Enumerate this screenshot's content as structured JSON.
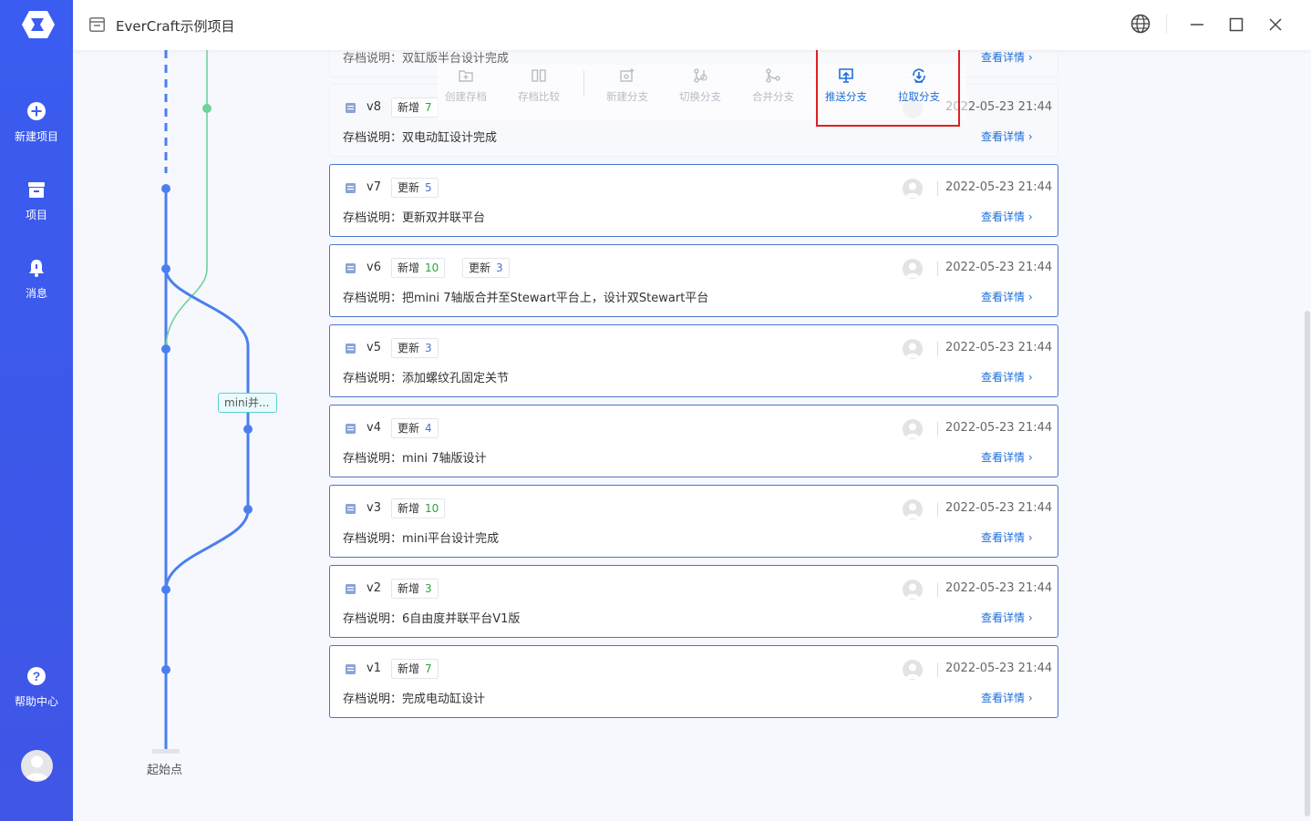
{
  "app": {
    "title": "EverCraft示例项目"
  },
  "sidebar": {
    "items": [
      {
        "label": "新建项目",
        "icon": "plus-circle-icon"
      },
      {
        "label": "项目",
        "icon": "archive-box-icon"
      },
      {
        "label": "消息",
        "icon": "bell-icon"
      },
      {
        "label": "帮助中心",
        "icon": "question-circle-icon"
      }
    ]
  },
  "toolbar": {
    "items": [
      {
        "label": "创建存档",
        "icon": "folder-plus-icon"
      },
      {
        "label": "存档比较",
        "icon": "compare-icon"
      },
      {
        "label": "新建分支",
        "icon": "new-branch-icon"
      },
      {
        "label": "切换分支",
        "icon": "switch-branch-icon"
      },
      {
        "label": "合并分支",
        "icon": "merge-branch-icon"
      },
      {
        "label": "推送分支",
        "icon": "push-branch-icon"
      },
      {
        "label": "拉取分支",
        "icon": "pull-branch-icon"
      }
    ]
  },
  "graph": {
    "start_label": "起始点",
    "branch_tag": "mini并..."
  },
  "top_partial": {
    "desc": "存档说明：双缸版半台设计完成",
    "detail": "查看详情"
  },
  "archives": [
    {
      "version": "v8",
      "tags": [
        {
          "label": "新增",
          "count": "7",
          "kind": "add"
        }
      ],
      "time": "2022-05-23 21:44",
      "desc": "存档说明：双电动缸设计完成",
      "detail": "查看详情"
    },
    {
      "version": "v7",
      "tags": [
        {
          "label": "更新",
          "count": "5",
          "kind": "update"
        }
      ],
      "time": "2022-05-23 21:44",
      "desc": "存档说明：更新双并联平台",
      "detail": "查看详情"
    },
    {
      "version": "v6",
      "tags": [
        {
          "label": "新增",
          "count": "10",
          "kind": "add"
        },
        {
          "label": "更新",
          "count": "3",
          "kind": "update"
        }
      ],
      "time": "2022-05-23 21:44",
      "desc": "存档说明：把mini 7轴版合并至Stewart平台上，设计双Stewart平台",
      "detail": "查看详情"
    },
    {
      "version": "v5",
      "tags": [
        {
          "label": "更新",
          "count": "3",
          "kind": "update"
        }
      ],
      "time": "2022-05-23 21:44",
      "desc": "存档说明：添加螺纹孔固定关节",
      "detail": "查看详情"
    },
    {
      "version": "v4",
      "tags": [
        {
          "label": "更新",
          "count": "4",
          "kind": "update"
        }
      ],
      "time": "2022-05-23 21:44",
      "desc": "存档说明：mini 7轴版设计",
      "detail": "查看详情"
    },
    {
      "version": "v3",
      "tags": [
        {
          "label": "新增",
          "count": "10",
          "kind": "add"
        }
      ],
      "time": "2022-05-23 21:44",
      "desc": "存档说明：mini平台设计完成",
      "detail": "查看详情"
    },
    {
      "version": "v2",
      "tags": [
        {
          "label": "新增",
          "count": "3",
          "kind": "add"
        }
      ],
      "time": "2022-05-23 21:44",
      "desc": "存档说明：6自由度并联平台V1版",
      "detail": "查看详情"
    },
    {
      "version": "v1",
      "tags": [
        {
          "label": "新增",
          "count": "7",
          "kind": "add"
        }
      ],
      "time": "2022-05-23 21:44",
      "desc": "存档说明：完成电动缸设计",
      "detail": "查看详情"
    }
  ],
  "colors": {
    "sidebar": "#3a5cf0",
    "accent": "#1e6fd6",
    "graph_main": "#4a80ee",
    "graph_side": "#6fd49a",
    "highlight": "#e02020"
  }
}
